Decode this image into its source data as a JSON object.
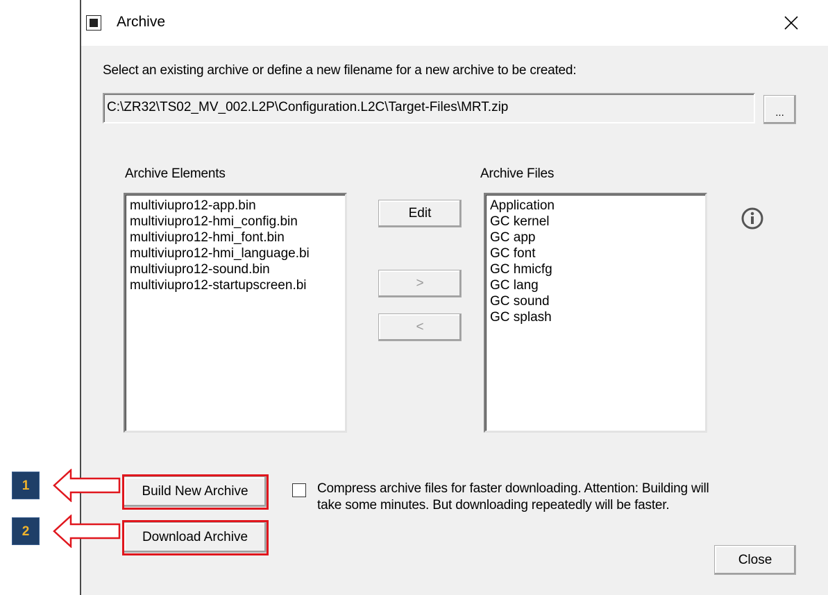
{
  "window": {
    "title": "Archive",
    "app_icon": "app-icon",
    "close_icon": "close-icon"
  },
  "prompt": "Select an existing archive or define a new filename for a new archive to be created:",
  "path_field": {
    "value": "C:\\ZR32\\TS02_MV_002.L2P\\Configuration.L2C\\Target-Files\\MRT.zip"
  },
  "browse_button": {
    "label": "..."
  },
  "archive_elements": {
    "label": "Archive Elements",
    "items": [
      "multiviupro12-app.bin",
      "multiviupro12-hmi_config.bin",
      "multiviupro12-hmi_font.bin",
      "multiviupro12-hmi_language.bi",
      "multiviupro12-sound.bin",
      "multiviupro12-startupscreen.bi"
    ]
  },
  "archive_files": {
    "label": "Archive Files",
    "items": [
      "Application",
      "GC kernel",
      "GC app",
      "GC font",
      "GC hmicfg",
      "GC lang",
      "GC sound",
      "GC splash"
    ]
  },
  "buttons": {
    "edit": "Edit",
    "move_right": ">",
    "move_left": "<",
    "build": "Build New Archive",
    "download": "Download Archive",
    "close": "Close"
  },
  "compress_option": {
    "checked": false,
    "line1": "Compress archive files for faster downloading. Attention: Building will",
    "line2": "take some minutes. But downloading repeatedly will be faster."
  },
  "annotations": {
    "badge1": "1",
    "badge2": "2",
    "highlight_color": "#e0161d",
    "badge_color": "#1f3f68",
    "badge_text_color": "#f2b42b"
  },
  "icons": {
    "info": "info-icon"
  }
}
